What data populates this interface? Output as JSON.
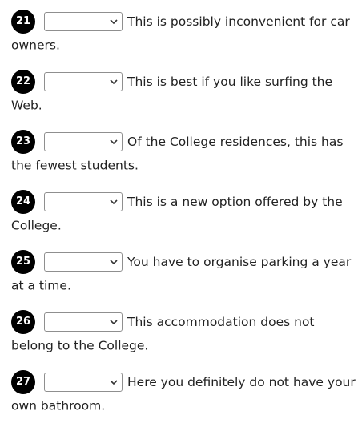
{
  "questions": [
    {
      "number": "21",
      "selected": "",
      "text": "This is possibly inconvenient for car owners."
    },
    {
      "number": "22",
      "selected": "",
      "text": "This is best if you like surfing the Web."
    },
    {
      "number": "23",
      "selected": "",
      "text": "Of the College residences, this has the fewest students."
    },
    {
      "number": "24",
      "selected": "",
      "text": "This is a new option offered by the College."
    },
    {
      "number": "25",
      "selected": "",
      "text": "You have to organise parking a year at a time."
    },
    {
      "number": "26",
      "selected": "",
      "text": "This accommodation does not belong to the College."
    },
    {
      "number": "27",
      "selected": "",
      "text": "Here you definitely do not have your own bathroom."
    }
  ],
  "icons": {
    "dropdown": "chevron-down-icon"
  },
  "colors": {
    "badge": "#000000",
    "badge_text": "#ffffff",
    "text": "#222222"
  }
}
